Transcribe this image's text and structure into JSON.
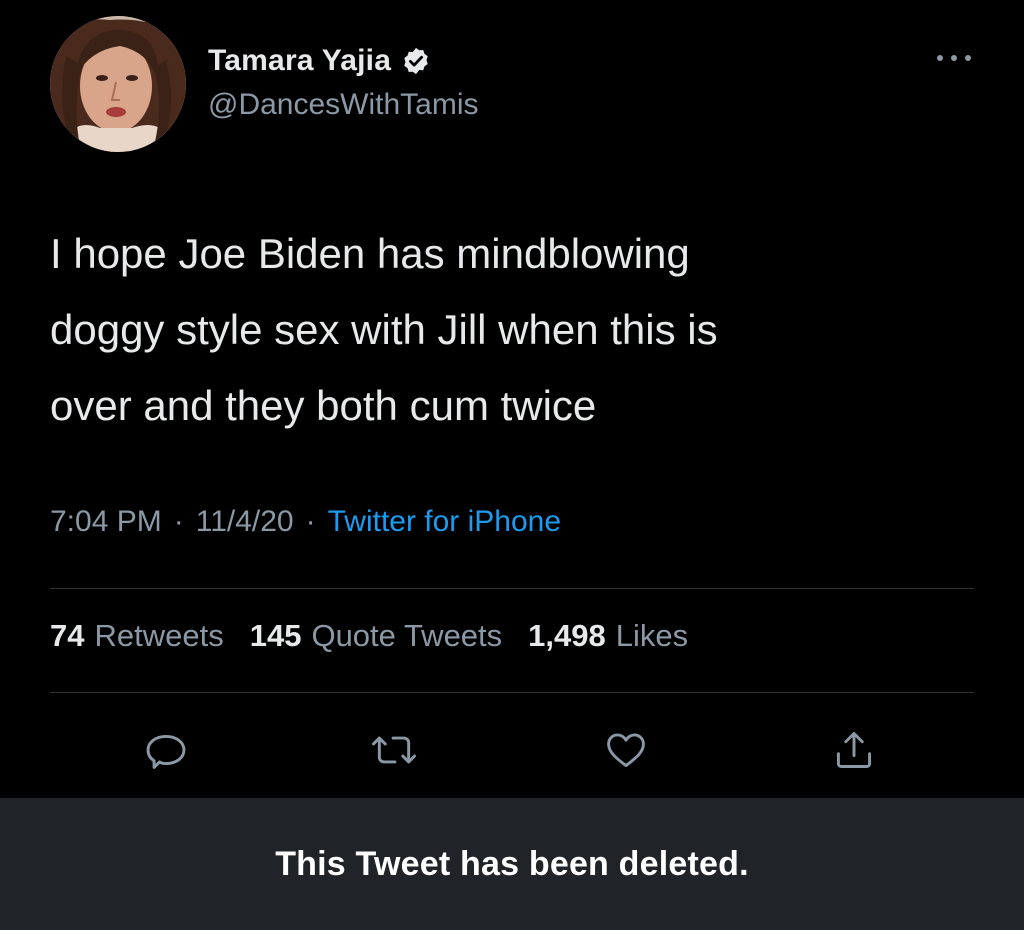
{
  "author": {
    "display_name": "Tamara Yajia",
    "handle": "@DancesWithTamis",
    "verified": true,
    "avatar_icon": "profile-photo"
  },
  "tweet": {
    "lines": [
      "I hope Joe Biden has mindblowing",
      "doggy style sex with Jill when this is",
      "over and they both cum twice"
    ],
    "time": "7:04 PM",
    "date": "11/4/20",
    "separator": "·",
    "source": "Twitter for iPhone"
  },
  "stats": {
    "retweets_count": "74",
    "retweets_label": "Retweets",
    "quotes_count": "145",
    "quotes_label": "Quote Tweets",
    "likes_count": "1,498",
    "likes_label": "Likes"
  },
  "actions": {
    "icons": [
      "reply-icon",
      "retweet-icon",
      "like-icon",
      "share-icon"
    ]
  },
  "deleted_notice": "This Tweet has been deleted.",
  "colors": {
    "background": "#000000",
    "text_primary": "#e7e9ea",
    "text_secondary": "#8b98a5",
    "link": "#1d9bf0",
    "divider": "#2f3336",
    "deleted_bar": "#202327"
  }
}
